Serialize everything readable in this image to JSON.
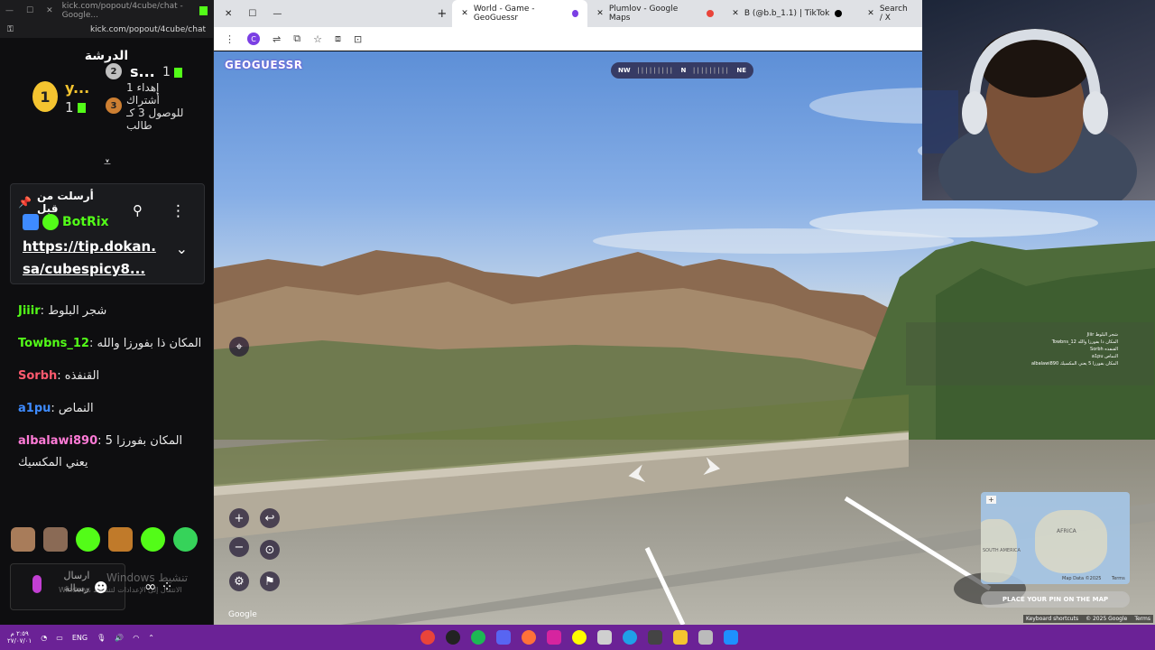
{
  "chat_window": {
    "title": "kick.com/popout/4cube/chat - Google...",
    "url": "kick.com/popout/4cube/chat",
    "header": "الدرشة",
    "leaderboard": {
      "first": {
        "rank": "1",
        "name": "y...",
        "gifts": "1"
      },
      "second": {
        "rank": "2",
        "name": "s...",
        "gifts": "1"
      },
      "third": {
        "rank": "3",
        "text": "إهداء 1 أشتراك للوصول 3 كـ طالب"
      }
    },
    "pinned": {
      "title": "أرسلت من قبل",
      "sender": "BotRix",
      "link_line1": "https://tip.dokan.",
      "link_line2": "sa/cubespicy8..."
    },
    "messages": [
      {
        "user": "Jiiir",
        "user_color": "#53fc18",
        "text": "شجر البلوط"
      },
      {
        "user": "Towbns_12",
        "user_color": "#53fc18",
        "text": "المكان ذا بفورزا والله"
      },
      {
        "user": "Sorbh",
        "user_color": "#ff5a6e",
        "text": "القنفذه"
      },
      {
        "user": "a1pu",
        "user_color": "#3e8bff",
        "text": "النماص"
      },
      {
        "user": "albalawi890",
        "user_color": "#ff7bd7",
        "text": "المكان بفورزا 5 يعني المكسيك"
      }
    ],
    "input_placeholder": "ارسال رسالة",
    "watermark_title": "Windows تنشيط",
    "watermark_sub": "Windows الانتقال إلى الإعدادات لتنشيط"
  },
  "browser": {
    "tabs": [
      {
        "label": "World - Game - GeoGuessr",
        "active": true,
        "color": "#7b3fe4"
      },
      {
        "label": "Plumlov - Google Maps",
        "active": false,
        "color": "#e9443a"
      },
      {
        "label": "B (@b.b_1.1) | TikTok",
        "active": false,
        "color": "#000000"
      },
      {
        "label": "Search / X",
        "active": false,
        "color": "#000000"
      }
    ],
    "profile_letter": "C"
  },
  "game": {
    "logo": "GEOGUESSR",
    "compass": {
      "left": "NW",
      "center": "N",
      "right": "NE"
    },
    "place_pin": "PLACE YOUR PIN ON THE MAP",
    "map_label": "AFRICA",
    "map_label2": "SOUTH AMERICA",
    "map_copyright": "Map Data ©2025",
    "map_terms": "Terms",
    "google_label": "Google",
    "footer": {
      "shortcuts": "Keyboard shortcuts",
      "copyright": "© 2025 Google",
      "terms": "Terms"
    }
  },
  "taskbar": {
    "time": "٢:٥٩ م",
    "date": "٢٧/٠٧/٠١",
    "language": "ENG"
  }
}
